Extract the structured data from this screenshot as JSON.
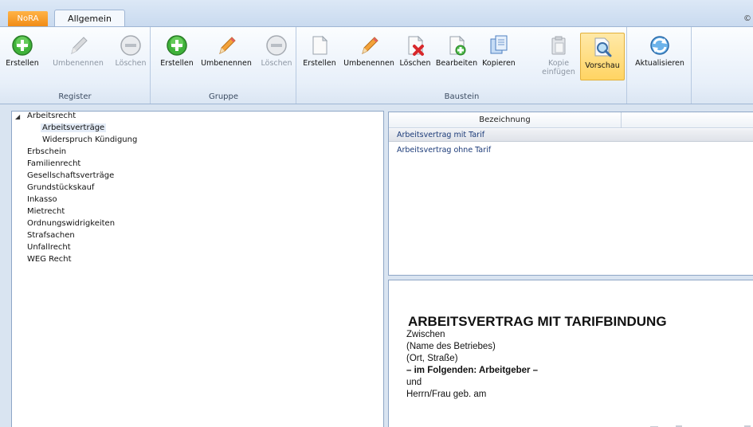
{
  "tabs": {
    "app_tab": "NoRA",
    "active_tab": "Allgemein",
    "corner_glyph": "©"
  },
  "ribbon": {
    "groups": [
      {
        "label": "Register",
        "buttons": [
          {
            "label": "Erstellen",
            "icon": "plus-circle-icon",
            "enabled": true
          },
          {
            "label": "Umbenennen",
            "icon": "pencil-icon",
            "enabled": false
          },
          {
            "label": "Löschen",
            "icon": "minus-circle-icon",
            "enabled": false
          }
        ]
      },
      {
        "label": "Gruppe",
        "buttons": [
          {
            "label": "Erstellen",
            "icon": "plus-circle-icon",
            "enabled": true
          },
          {
            "label": "Umbenennen",
            "icon": "pencil-icon",
            "enabled": true
          },
          {
            "label": "Löschen",
            "icon": "minus-circle-icon",
            "enabled": false
          }
        ]
      },
      {
        "label": "Baustein",
        "buttons": [
          {
            "label": "Erstellen",
            "icon": "new-document-icon",
            "enabled": true
          },
          {
            "label": "Umbenennen",
            "icon": "pencil-icon",
            "enabled": true
          },
          {
            "label": "Löschen",
            "icon": "delete-document-icon",
            "enabled": true
          },
          {
            "label": "Bearbeiten",
            "icon": "edit-document-icon",
            "enabled": true
          },
          {
            "label": "Kopieren",
            "icon": "copy-document-icon",
            "enabled": true
          },
          {
            "label": "Kopie",
            "label2": "einfügen",
            "icon": "paste-document-icon",
            "enabled": false
          },
          {
            "label": "Vorschau",
            "icon": "preview-icon",
            "enabled": true,
            "active": true
          }
        ]
      },
      {
        "label": "",
        "buttons": [
          {
            "label": "Aktualisieren",
            "icon": "refresh-icon",
            "enabled": true
          }
        ]
      }
    ]
  },
  "tree": {
    "expander": "◢",
    "items": [
      {
        "label": "Arbeitsrecht",
        "level": 0
      },
      {
        "label": "Arbeitsverträge",
        "level": 1,
        "selected": true
      },
      {
        "label": "Widerspruch Kündigung",
        "level": 1
      },
      {
        "label": "Erbschein",
        "level": 0
      },
      {
        "label": "Familienrecht",
        "level": 0
      },
      {
        "label": "Gesellschaftsverträge",
        "level": 0
      },
      {
        "label": "Grundstückskauf",
        "level": 0
      },
      {
        "label": "Inkasso",
        "level": 0
      },
      {
        "label": "Mietrecht",
        "level": 0
      },
      {
        "label": "Ordnungswidrigkeiten",
        "level": 0
      },
      {
        "label": "Strafsachen",
        "level": 0
      },
      {
        "label": "Unfallrecht",
        "level": 0
      },
      {
        "label": "WEG Recht",
        "level": 0
      }
    ]
  },
  "grid": {
    "column_header": "Bezeichnung",
    "rows": [
      {
        "label": "Arbeitsvertrag mit Tarif",
        "selected": true
      },
      {
        "label": "Arbeitsvertrag ohne Tarif",
        "selected": false
      }
    ]
  },
  "preview": {
    "title": "ARBEITSVERTRAG MIT TARIFBINDUNG",
    "lines": [
      {
        "text": "Zwischen",
        "bold": false
      },
      {
        "text": "(Name des Betriebes)",
        "bold": false
      },
      {
        "text": "(Ort, Straße)",
        "bold": false
      },
      {
        "text": "– im Folgenden: Arbeitgeber –",
        "bold": true
      },
      {
        "text": "und",
        "bold": false
      },
      {
        "text": "Herrn/Frau geb. am",
        "bold": false
      }
    ]
  },
  "colors": {
    "app_tab": "#f08a13",
    "active_button": "#ffd463",
    "selection": "#e4ecf7",
    "link_text": "#1b3a78"
  }
}
